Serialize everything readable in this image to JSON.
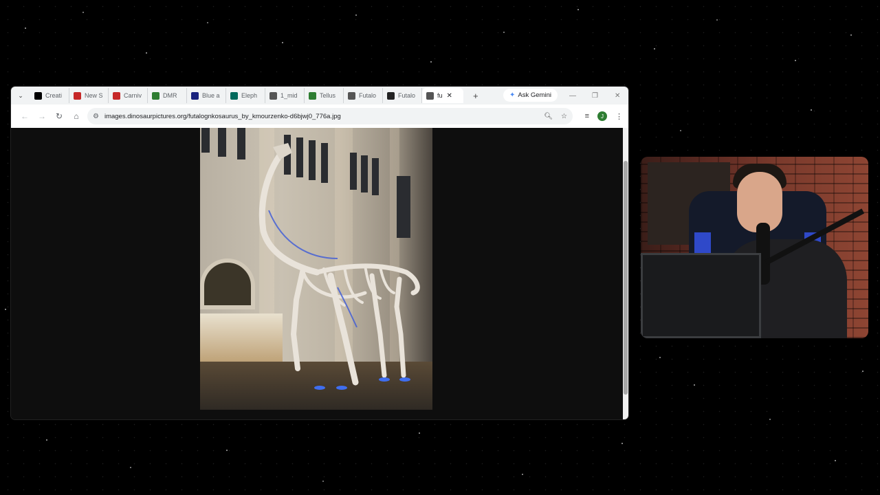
{
  "browser": {
    "tabs": [
      {
        "label": "Creati",
        "icon": "x-logo-icon",
        "color": "#000000"
      },
      {
        "label": "New S",
        "icon": "favicon-icon",
        "color": "#c62828"
      },
      {
        "label": "Carniv",
        "icon": "favicon-icon",
        "color": "#c62828"
      },
      {
        "label": "DMR",
        "icon": "favicon-icon",
        "color": "#2e7d32"
      },
      {
        "label": "Blue a",
        "icon": "favicon-icon",
        "color": "#1a237e"
      },
      {
        "label": "Eleph",
        "icon": "favicon-icon",
        "color": "#00695c"
      },
      {
        "label": "1_mid",
        "icon": "globe-icon",
        "color": "#555555"
      },
      {
        "label": "Tellus",
        "icon": "favicon-icon",
        "color": "#2e7d32"
      },
      {
        "label": "Futalo",
        "icon": "globe-icon",
        "color": "#555555"
      },
      {
        "label": "Futalo",
        "icon": "favicon-icon",
        "color": "#222222"
      },
      {
        "label": "fu",
        "icon": "globe-icon",
        "color": "#555555",
        "active": true
      }
    ],
    "new_tab_symbol": "+",
    "gemini_label": "Ask Gemini",
    "url": "images.dinosaurpictures.org/futalognkosaurus_by_kmourzenko-d6bjwj0_776a.jpg",
    "profile_initial": "J"
  }
}
